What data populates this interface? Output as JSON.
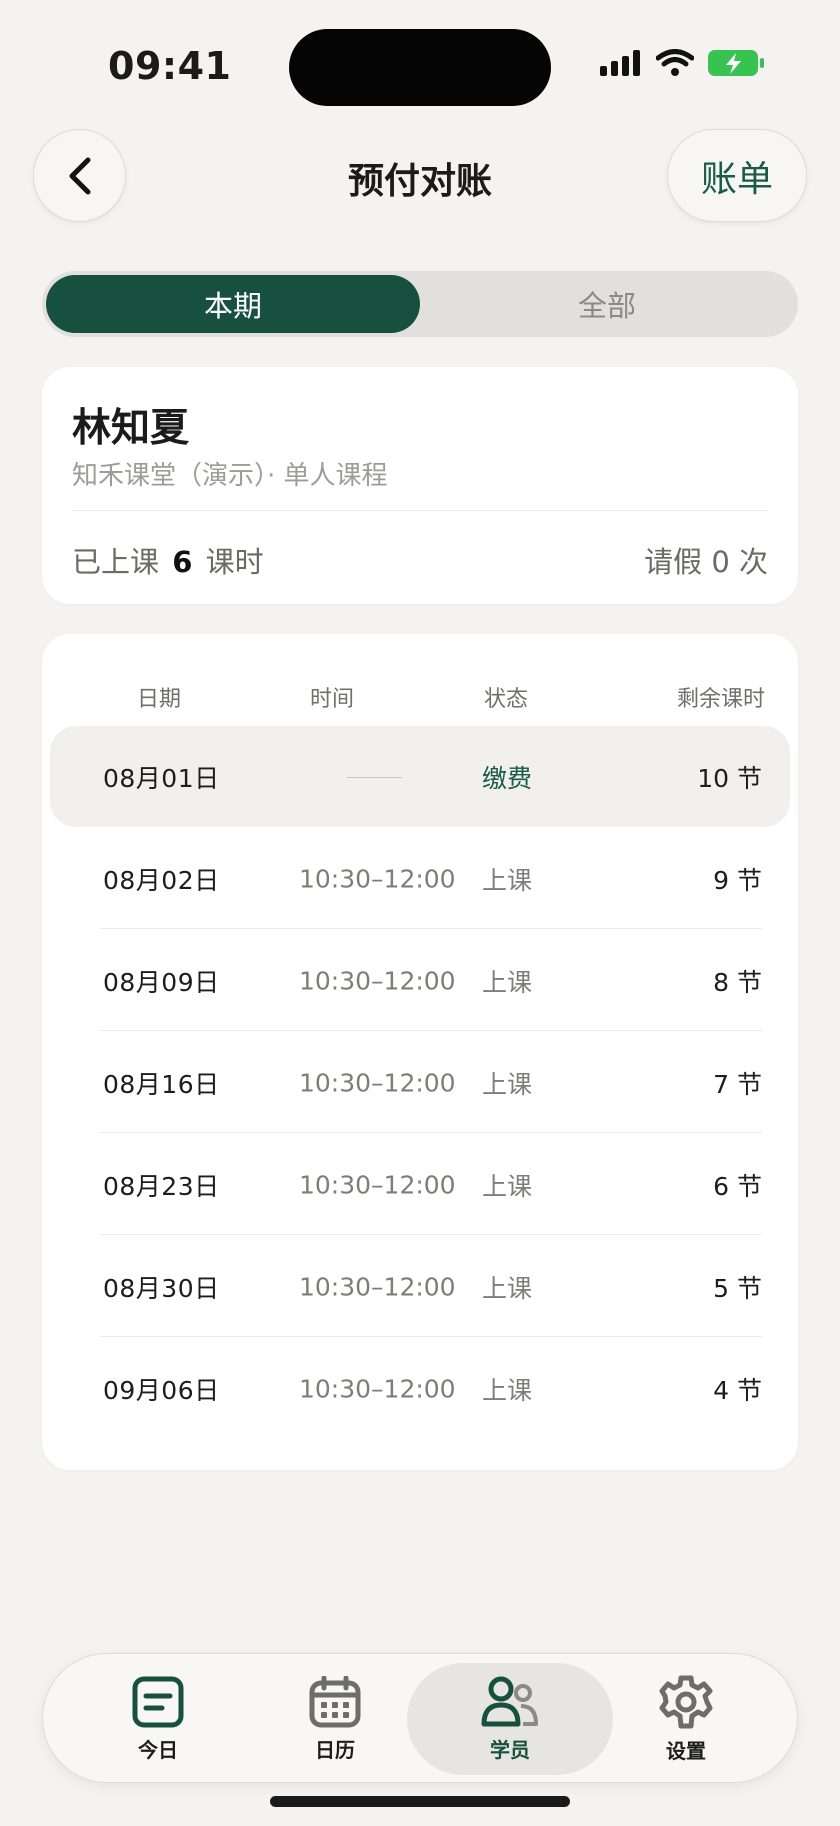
{
  "status_bar": {
    "time": "09:41"
  },
  "header": {
    "title": "预付对账",
    "bill_label": "账单"
  },
  "segments": {
    "current": "本期",
    "all": "全部"
  },
  "student": {
    "name": "林知夏",
    "subtitle": "知禾课堂（演示）· 单人课程",
    "attended_prefix": "已上课",
    "attended_count": "6",
    "attended_suffix": "课时",
    "leave_text": "请假 0 次"
  },
  "table": {
    "headers": {
      "date": "日期",
      "time": "时间",
      "status": "状态",
      "remaining": "剩余课时"
    },
    "rows": [
      {
        "date": "08月01日",
        "time": "",
        "status": "缴费",
        "remaining": "10 节"
      },
      {
        "date": "08月02日",
        "time": "10:30–12:00",
        "status": "上课",
        "remaining": "9 节"
      },
      {
        "date": "08月09日",
        "time": "10:30–12:00",
        "status": "上课",
        "remaining": "8 节"
      },
      {
        "date": "08月16日",
        "time": "10:30–12:00",
        "status": "上课",
        "remaining": "7 节"
      },
      {
        "date": "08月23日",
        "time": "10:30–12:00",
        "status": "上课",
        "remaining": "6 节"
      },
      {
        "date": "08月30日",
        "time": "10:30–12:00",
        "status": "上课",
        "remaining": "5 节"
      },
      {
        "date": "09月06日",
        "time": "10:30–12:00",
        "status": "上课",
        "remaining": "4 节"
      }
    ]
  },
  "tabbar": {
    "items": [
      {
        "label": "今日",
        "icon": "today-icon"
      },
      {
        "label": "日历",
        "icon": "calendar-icon"
      },
      {
        "label": "学员",
        "icon": "students-icon"
      },
      {
        "label": "设置",
        "icon": "settings-icon"
      }
    ]
  },
  "colors": {
    "accent": "#17503f",
    "paid": "#1a5a48",
    "background": "#f4f3f1"
  }
}
